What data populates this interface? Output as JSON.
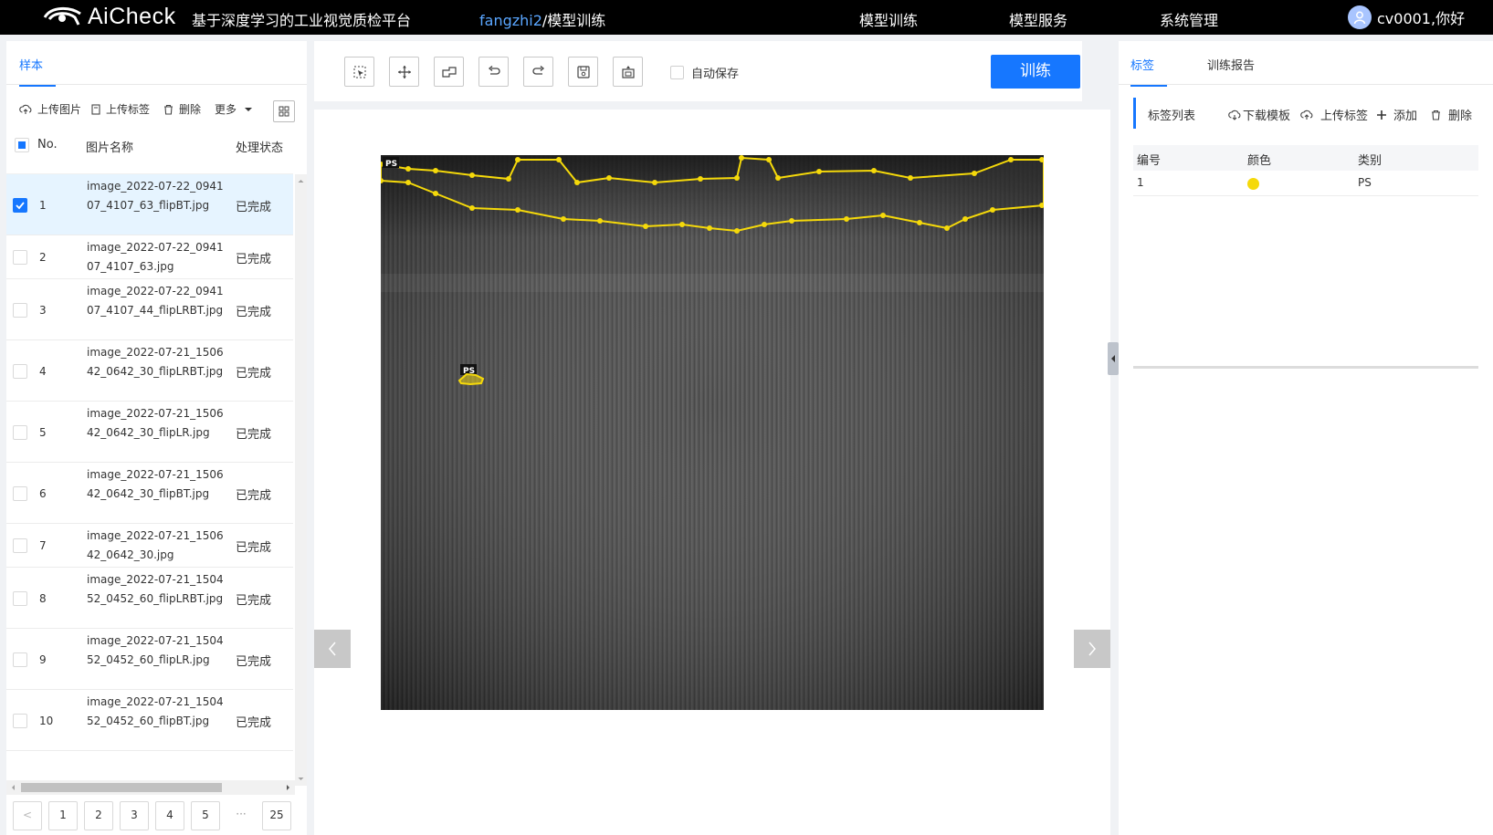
{
  "header": {
    "brand": "AiCheck",
    "platform_name": "基于深度学习的工业视觉质检平台",
    "breadcrumb": {
      "project": "fangzhi2",
      "separator": "/",
      "current": "模型训练"
    },
    "nav": [
      "模型训练",
      "模型服务",
      "系统管理"
    ],
    "user_greeting": "cv0001,你好"
  },
  "left_panel": {
    "tab": "样本",
    "toolbar": {
      "upload_image": "上传图片",
      "upload_label": "上传标签",
      "delete": "删除",
      "more": "更多"
    },
    "columns": {
      "no": "No.",
      "name": "图片名称",
      "status": "处理状态"
    },
    "rows": [
      {
        "no": "1",
        "name": "image_2022-07-22_094107_4107_63_flipBT.jpg",
        "status": "已完成",
        "selected": true
      },
      {
        "no": "2",
        "name": "image_2022-07-22_094107_4107_63.jpg",
        "status": "已完成",
        "selected": false
      },
      {
        "no": "3",
        "name": "image_2022-07-22_094107_4107_44_flipLRBT.jpg",
        "status": "已完成",
        "selected": false
      },
      {
        "no": "4",
        "name": "image_2022-07-21_150642_0642_30_flipLRBT.jpg",
        "status": "已完成",
        "selected": false
      },
      {
        "no": "5",
        "name": "image_2022-07-21_150642_0642_30_flipLR.jpg",
        "status": "已完成",
        "selected": false
      },
      {
        "no": "6",
        "name": "image_2022-07-21_150642_0642_30_flipBT.jpg",
        "status": "已完成",
        "selected": false
      },
      {
        "no": "7",
        "name": "image_2022-07-21_150642_0642_30.jpg",
        "status": "已完成",
        "selected": false
      },
      {
        "no": "8",
        "name": "image_2022-07-21_150452_0452_60_flipLRBT.jpg",
        "status": "已完成",
        "selected": false
      },
      {
        "no": "9",
        "name": "image_2022-07-21_150452_0452_60_flipLR.jpg",
        "status": "已完成",
        "selected": false
      },
      {
        "no": "10",
        "name": "image_2022-07-21_150452_0452_60_flipBT.jpg",
        "status": "已完成",
        "selected": false
      }
    ],
    "pagination": {
      "pages": [
        "1",
        "2",
        "3",
        "4",
        "5"
      ],
      "ellipsis": "···",
      "last": "25",
      "prev": "<"
    }
  },
  "center": {
    "tool_icons": [
      "select-icon",
      "move-icon",
      "polygon-icon",
      "undo-icon",
      "redo-icon",
      "save-icon",
      "fit-icon"
    ],
    "autosave_label": "自动保存",
    "train_button": "训练",
    "annotation_tags": [
      "PS",
      "PS"
    ],
    "annotation_color": "#f5d90a"
  },
  "right_panel": {
    "tabs": [
      "标签",
      "训练报告"
    ],
    "label_list_title": "标签列表",
    "actions": {
      "download_template": "下载模板",
      "upload_label": "上传标签",
      "add": "添加",
      "delete": "删除"
    },
    "columns": {
      "id": "编号",
      "color": "颜色",
      "category": "类别"
    },
    "rows": [
      {
        "id": "1",
        "color": "#f5d90a",
        "category": "PS"
      }
    ]
  },
  "colors": {
    "accent": "#1677ff",
    "topbar": "#000000",
    "annotation": "#f5d90a"
  }
}
